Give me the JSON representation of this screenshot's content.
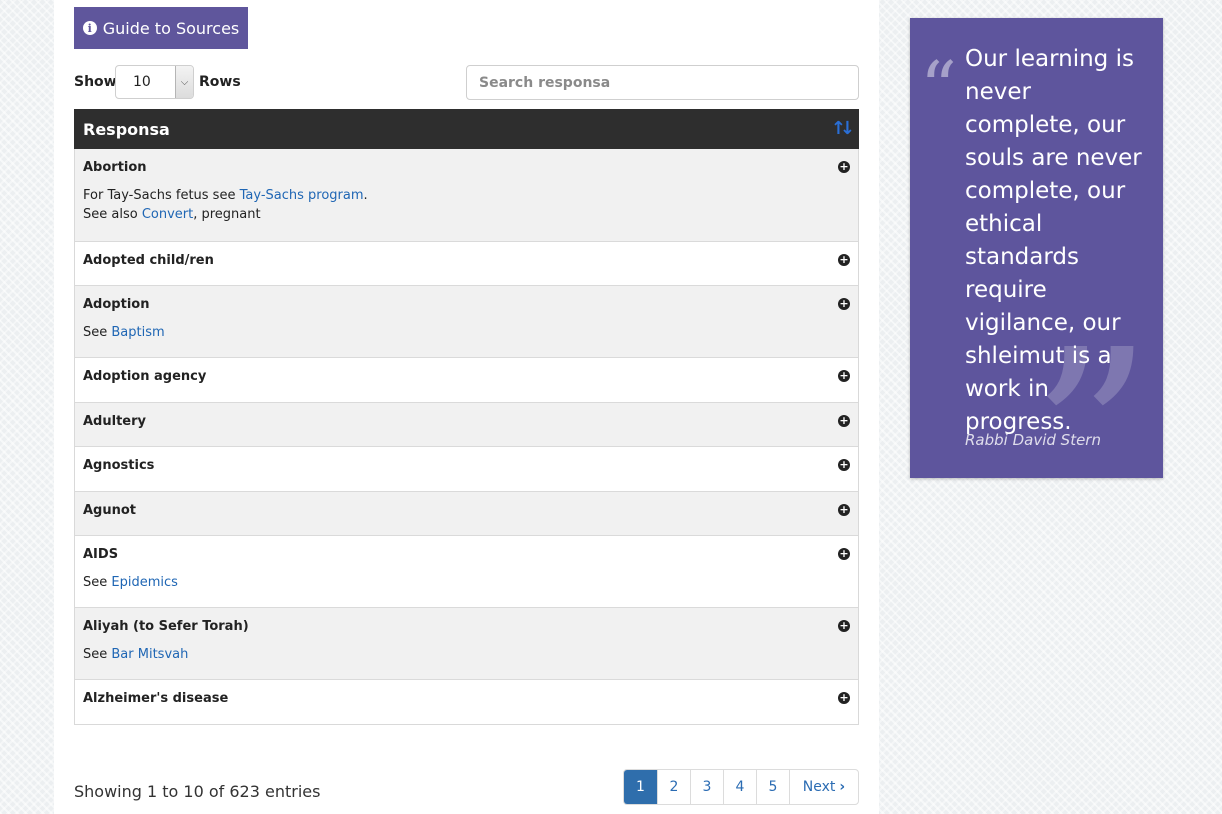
{
  "guide_button": {
    "label": "Guide to Sources",
    "icon": "info-circle-icon"
  },
  "controls": {
    "show_label": "Show",
    "rows_value": "10",
    "rows_label": "Rows",
    "search_placeholder": "Search responsa"
  },
  "table": {
    "header": "Responsa",
    "rows": [
      {
        "title": "Abortion",
        "notes": [
          [
            {
              "t": "For Tay-Sachs fetus see "
            },
            {
              "t": "Tay-Sachs program",
              "link": true
            },
            {
              "t": "."
            }
          ],
          [
            {
              "t": "See also "
            },
            {
              "t": "Convert",
              "link": true
            },
            {
              "t": ", pregnant"
            }
          ]
        ]
      },
      {
        "title": "Adopted child/ren",
        "notes": []
      },
      {
        "title": "Adoption",
        "notes": [
          [
            {
              "t": "See "
            },
            {
              "t": "Baptism",
              "link": true
            }
          ]
        ]
      },
      {
        "title": "Adoption agency",
        "notes": []
      },
      {
        "title": "Adultery",
        "notes": []
      },
      {
        "title": "Agnostics",
        "notes": []
      },
      {
        "title": "Agunot",
        "notes": []
      },
      {
        "title": "AIDS",
        "notes": [
          [
            {
              "t": "See "
            },
            {
              "t": "Epidemics",
              "link": true
            }
          ]
        ]
      },
      {
        "title": "Aliyah (to Sefer Torah)",
        "notes": [
          [
            {
              "t": "See "
            },
            {
              "t": "Bar Mitsvah",
              "link": true
            }
          ]
        ]
      },
      {
        "title": "Alzheimer's disease",
        "notes": []
      }
    ]
  },
  "footer": {
    "showing": "Showing 1 to 10 of 623 entries",
    "pages": [
      "1",
      "2",
      "3",
      "4",
      "5"
    ],
    "active_page": "1",
    "next_label": "Next"
  },
  "quote": {
    "text": "Our learning is never complete, our souls are never complete, our ethical standards require vigilance, our shleimut is a work in progress.",
    "author": "Rabbi David Stern"
  },
  "colors": {
    "accent_purple": "#5f569c",
    "header_dark": "#2e2e2e",
    "link_blue": "#1f66b4",
    "page_active": "#2f6eac"
  }
}
